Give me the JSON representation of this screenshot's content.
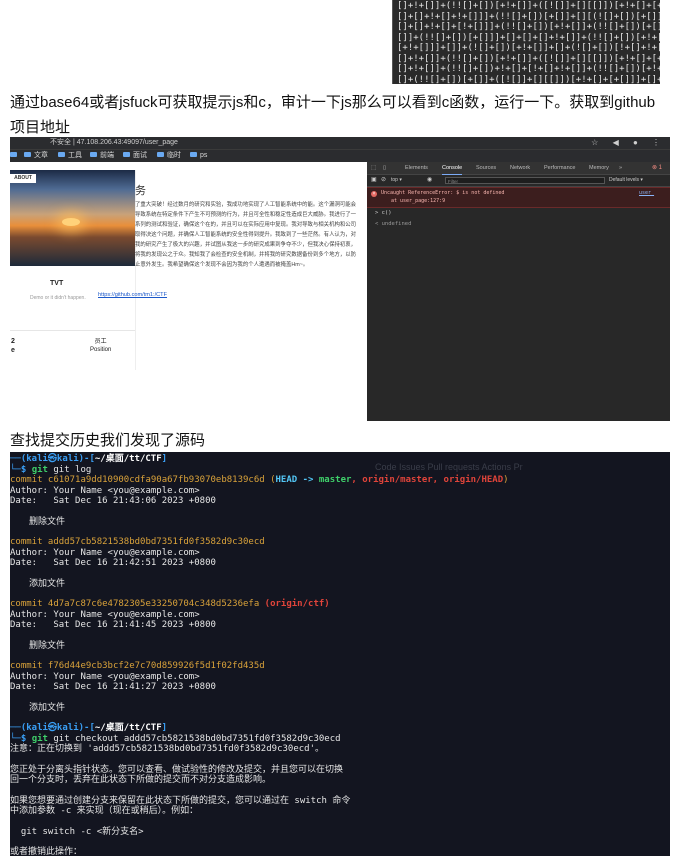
{
  "jsfuck": {
    "lines": [
      "[]+!+[]]+(!![]+[])[+!+[]]+([![]]+[][[]])[+!+[]+[+[]]]+([",
      "[]+[]+!+[]+!+[]]]+(!![]+[])[+[]]+[][(![]+[])[+[]]+([![]",
      "[]+[]+!+[]+[!+[]]]+(!![]+[])[+!+[]]+(!![]+[])[+[]]+([!+",
      "[]]+(!![]+[])[+[]]]+[]+[]+[]+!+[]]+(!![]+[])[+!+[]]+[!+",
      "[+!+[]]]+[]]+(![]+[])[+!+[]]+[]+(![]+[])[!+[]+!+[]]+[]+",
      "[]+!+[]]+(!![]+[])[+!+[]]+([![]]+[][[]])[+!+[]+[+[]]]+[",
      "[]+!+[]]+(!![]+[])+!+[]+[!+[]+!+[]]+(!![]+[])[+!+[]]+[",
      "[]+(!![]+[])[+[]]+([![]]+[][[]])[+!+[]+[+[]]]+[]+!+[]+"
    ]
  },
  "para1": "通过base64或者jsfuck可获取提示js和c，审计一下js那么可以看到c函数，运行一下。获取到github 项目地址",
  "browser": {
    "url": "不安全 | 47.108.206.43:49097/user_page",
    "url_icons": "☆ ◀ ● ⋮",
    "bookmarks": [
      "文章",
      "工具",
      "前端",
      "面试",
      "临时",
      "ps"
    ],
    "badge": "ABOUT",
    "card_name": "TVT",
    "card_sub": "Demo or it didn't happen.",
    "stat_num": "2",
    "stat_num2": "e",
    "stat_label": "员工",
    "stat_label2": "Position",
    "page_title": "务",
    "page_text": "了重大突破！经过数月的研究和实验，我成功地实现了人工智能系统中的能。这个漏洞可能会导致系统在特定条件下产生不可预测的行为，并且可全性和稳定性造成巨大威胁。我进行了一系列的测试和验证，确保这个在的，并且可以在实际应用中复现。我对导致与相关机构和公司取得决这个问题，并确保人工智能系统的安全性得到提升。我致到了一些茫然。有人认为，对我的研究产生了极大的兴趣，并试图从我这一步的研究成果到争夺不少，但我决心保持初衷，将我的发现公之于众。我知我了会检查的安全机制，并将我的研究数据备份到多个地方，以防止意外发生。我希望确保这个发现不会因为我的个人遭遇而被掩盖Hm~。",
    "link": "https://github.com/tm1:/CTF",
    "devtools": {
      "tabs": [
        "Elements",
        "Console",
        "Sources",
        "Network",
        "Performance",
        "Memory",
        "»"
      ],
      "err_count": "⊗ 1",
      "top": "top ▾",
      "filter": "Filter",
      "levels": "Default levels ▾",
      "error_text": "Uncaught ReferenceError: $ is not defined",
      "error_at": "at user_page:127:9",
      "error_link": "user_",
      "line1": "> c()",
      "line2": "< undefined"
    }
  },
  "para2": "查找提交历史我们发现了源码",
  "terminal": {
    "ghost": "Code   Issues   Pull requests   Actions   Pr",
    "prompt_user": "(kali㉿kali)",
    "prompt_path": "~/桌面/tt/CTF",
    "cmd1": "git log",
    "commits": [
      {
        "hash": "commit c61071a9dd10900cdfa90a67fb93070eb8139c6d",
        "refs_head": "HEAD",
        "arrow": " -> ",
        "refs_master": "master",
        "refs_rest": ", origin/master, origin/HEAD",
        "author": "Author: Your Name <you@example.com>",
        "date": "Date:   Sat Dec 16 21:43:06 2023 +0800",
        "msg": "删除文件"
      },
      {
        "hash": "commit addd57cb5821538bd0bd7351fd0f3582d9c30ecd",
        "author": "Author: Your Name <you@example.com>",
        "date": "Date:   Sat Dec 16 21:42:51 2023 +0800",
        "msg": "添加文件"
      },
      {
        "hash": "commit 4d7a7c87c6e4782305e33250704c348d5236efa",
        "refs_ctf": "(origin/ctf)",
        "author": "Author: Your Name <you@example.com>",
        "date": "Date:   Sat Dec 16 21:41:45 2023 +0800",
        "msg": "删除文件"
      },
      {
        "hash": "commit f76d44e9cb3bcf2e7c70d859926f5d1f02fd435d",
        "author": "Author: Your Name <you@example.com>",
        "date": "Date:   Sat Dec 16 21:41:27 2023 +0800",
        "msg": "添加文件"
      }
    ],
    "cmd2": "git checkout addd57cb5821538bd0bd7351fd0f3582d9c30ecd",
    "out": [
      "注意：正在切换到 'addd57cb5821538bd0bd7351fd0f3582d9c30ecd'。",
      "",
      "您正处于分离头指针状态。您可以查看、做试验性的修改及提交，并且您可以在切换",
      "回一个分支时，丢弃在此状态下所做的提交而不对分支造成影响。",
      "",
      "如果您想要通过创建分支来保留在此状态下所做的提交，您可以通过在 switch 命令",
      "中添加参数 -c 来实现（现在或稍后）。例如：",
      "",
      "  git switch -c <新分支名>",
      "",
      "或者撤销此操作："
    ]
  }
}
